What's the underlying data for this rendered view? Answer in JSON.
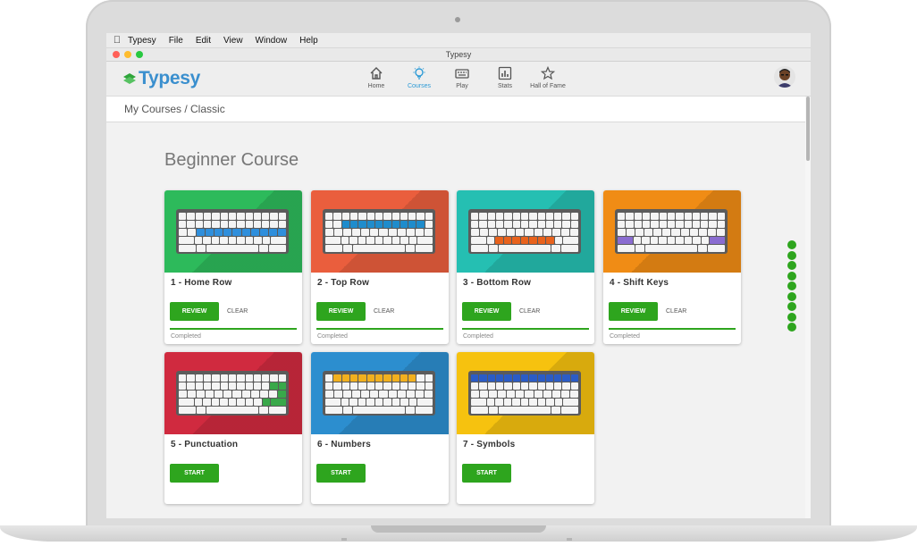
{
  "menubar": {
    "items": [
      "Typesy",
      "File",
      "Edit",
      "View",
      "Window",
      "Help"
    ]
  },
  "window": {
    "title": "Typesy"
  },
  "app": {
    "logo": "Typesy",
    "nav": [
      {
        "label": "Home",
        "icon": "home-icon"
      },
      {
        "label": "Courses",
        "icon": "lightbulb-icon",
        "active": true
      },
      {
        "label": "Play",
        "icon": "keyboard-icon"
      },
      {
        "label": "Stats",
        "icon": "stats-icon"
      },
      {
        "label": "Hall of Fame",
        "icon": "star-icon"
      }
    ]
  },
  "breadcrumb": "My Courses / Classic",
  "course": {
    "title": "Beginner Course",
    "lessons": [
      {
        "name": "1 - Home Row",
        "color": "#2dba5b",
        "highlight": "#2f8fdc",
        "primary": "REVIEW",
        "secondary": "CLEAR",
        "status": "Completed",
        "progress": 1.0
      },
      {
        "name": "2 - Top Row",
        "color": "#ea5e3d",
        "highlight": "#1f8ccc",
        "primary": "REVIEW",
        "secondary": "CLEAR",
        "status": "Completed",
        "progress": 1.0
      },
      {
        "name": "3 - Bottom Row",
        "color": "#25bfb2",
        "highlight": "#e8621c",
        "primary": "REVIEW",
        "secondary": "CLEAR",
        "status": "Completed",
        "progress": 1.0
      },
      {
        "name": "4 - Shift Keys",
        "color": "#f08c15",
        "highlight": "#8a6cd1",
        "primary": "REVIEW",
        "secondary": "CLEAR",
        "status": "Completed",
        "progress": 1.0
      },
      {
        "name": "5 - Punctuation",
        "color": "#d02a3f",
        "highlight": "#39a84a",
        "primary": "START"
      },
      {
        "name": "6 - Numbers",
        "color": "#2c8ecf",
        "highlight": "#f2b01e",
        "primary": "START"
      },
      {
        "name": "7 - Symbols",
        "color": "#f6c20f",
        "highlight": "#2b5cc6",
        "primary": "START"
      }
    ]
  },
  "colors": {
    "accent": "#2ea51e",
    "nav_active": "#2e9bd6"
  },
  "page_indicator": {
    "count": 9
  }
}
